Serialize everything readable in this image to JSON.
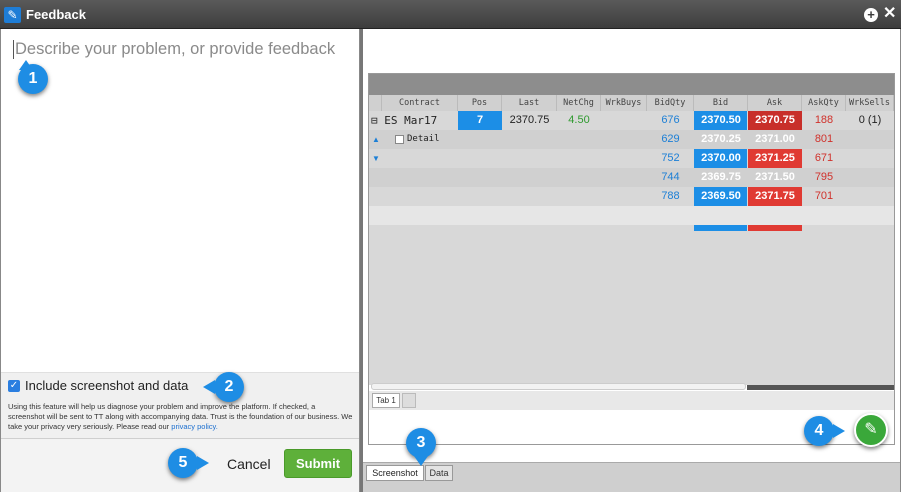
{
  "window": {
    "title": "Feedback"
  },
  "left": {
    "placeholder": "Describe your problem, or provide feedback",
    "include_label": "Include screenshot and data",
    "include_checked": true,
    "include_desc": "Using this feature will help us diagnose your problem and improve the platform. If checked, a screenshot will be sent to TT along with accompanying data. Trust is the foundation of our business. We take your privacy very seriously. Please read our",
    "privacy_link": "privacy policy.",
    "cancel": "Cancel",
    "submit": "Submit"
  },
  "grid": {
    "headers": [
      "Contract",
      "Pos",
      "Last",
      "NetChg",
      "WrkBuys",
      "BidQty",
      "Bid",
      "Ask",
      "AskQty",
      "WrkSells"
    ],
    "contract_label": "⊟ ES Mar17",
    "detail_label": "Detail",
    "pos": "7",
    "last": "2370.75",
    "netchg": "4.50",
    "wrksells": "0 (1)",
    "rows": [
      {
        "bidqty": "676",
        "bid": "2370.50",
        "ask": "2370.75",
        "askqty": "188"
      },
      {
        "bidqty": "629",
        "bid": "2370.25",
        "ask": "2371.00",
        "askqty": "801"
      },
      {
        "bidqty": "752",
        "bid": "2370.00",
        "ask": "2371.25",
        "askqty": "671"
      },
      {
        "bidqty": "744",
        "bid": "2369.75",
        "ask": "2371.50",
        "askqty": "795"
      },
      {
        "bidqty": "788",
        "bid": "2369.50",
        "ask": "2371.75",
        "askqty": "701"
      }
    ],
    "tab1": "Tab 1"
  },
  "bottom_tabs": {
    "screenshot": "Screenshot",
    "data": "Data"
  },
  "callouts": {
    "c1": "1",
    "c2": "2",
    "c3": "3",
    "c4": "4",
    "c5": "5"
  },
  "colors": {
    "bid": "#1c8ee6",
    "ask": "#e03a33",
    "callout": "#1e8de4",
    "submit": "#5eb03a"
  }
}
